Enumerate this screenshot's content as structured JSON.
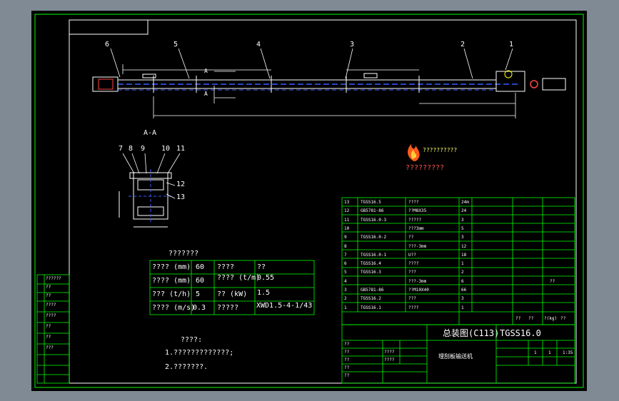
{
  "drawing": {
    "balloons": [
      "6",
      "5",
      "4",
      "3",
      "2",
      "1"
    ],
    "section_label": "A-A",
    "section_markers": [
      "A",
      "A"
    ],
    "section_balloons": [
      "7",
      "8",
      "9",
      "10",
      "11",
      "12",
      "13"
    ],
    "logo_text": "??????????",
    "logo_caption": "?????????"
  },
  "params": {
    "title": "???????",
    "rows": [
      [
        "????  (mm)",
        "60",
        "????",
        "??"
      ],
      [
        "????  (mm)",
        "60",
        "????  (t/m)",
        "0.55"
      ],
      [
        "???  (t/h)",
        "5",
        "??  (kW)",
        "1.5"
      ],
      [
        "????  (m/s)",
        "0.3",
        "?????",
        "XWD1.5-4-1/43"
      ]
    ]
  },
  "notes": {
    "title": "????:",
    "lines": [
      "1.?????????????;",
      "2.???????."
    ]
  },
  "bom": {
    "rows": [
      [
        "13",
        "TGSS16.5",
        "????",
        "24m",
        ""
      ],
      [
        "12",
        "GB5781-86",
        "??M8X35",
        "24",
        ""
      ],
      [
        "11",
        "TGSS16.0-3",
        "?????",
        "3",
        ""
      ],
      [
        "10",
        "",
        "???3mm",
        "5",
        ""
      ],
      [
        "9",
        "TGSS16.0-2",
        "??",
        "3",
        ""
      ],
      [
        "8",
        "",
        "???-3mm",
        "12",
        ""
      ],
      [
        "7",
        "TGSS16.0-1",
        "U??",
        "18",
        ""
      ],
      [
        "6",
        "TGSS16.4",
        "????",
        "1",
        ""
      ],
      [
        "5",
        "TGSS16.3",
        "???",
        "2",
        ""
      ],
      [
        "4",
        "",
        "???-3mm",
        "6",
        "??"
      ],
      [
        "3",
        "GB5781-86",
        "??M10X40",
        "66",
        ""
      ],
      [
        "2",
        "TGSS16.2",
        "???",
        "3",
        ""
      ],
      [
        "1",
        "TGSS16.1",
        "????",
        "1",
        ""
      ]
    ],
    "header_bits": [
      "??",
      "??",
      "?(kg)",
      "??"
    ]
  },
  "title_block": {
    "assembly": "总装图(C113)",
    "code": "TGSS16.0",
    "product": "埋刮板输送机",
    "scale": "1:35",
    "sheet": [
      "1",
      "1"
    ],
    "cells": [
      "??",
      "??",
      "??",
      "??",
      "??",
      "????",
      "????"
    ]
  },
  "left_strip": [
    "??????",
    "??",
    "??",
    "????",
    "????",
    "??",
    "??",
    "???"
  ]
}
